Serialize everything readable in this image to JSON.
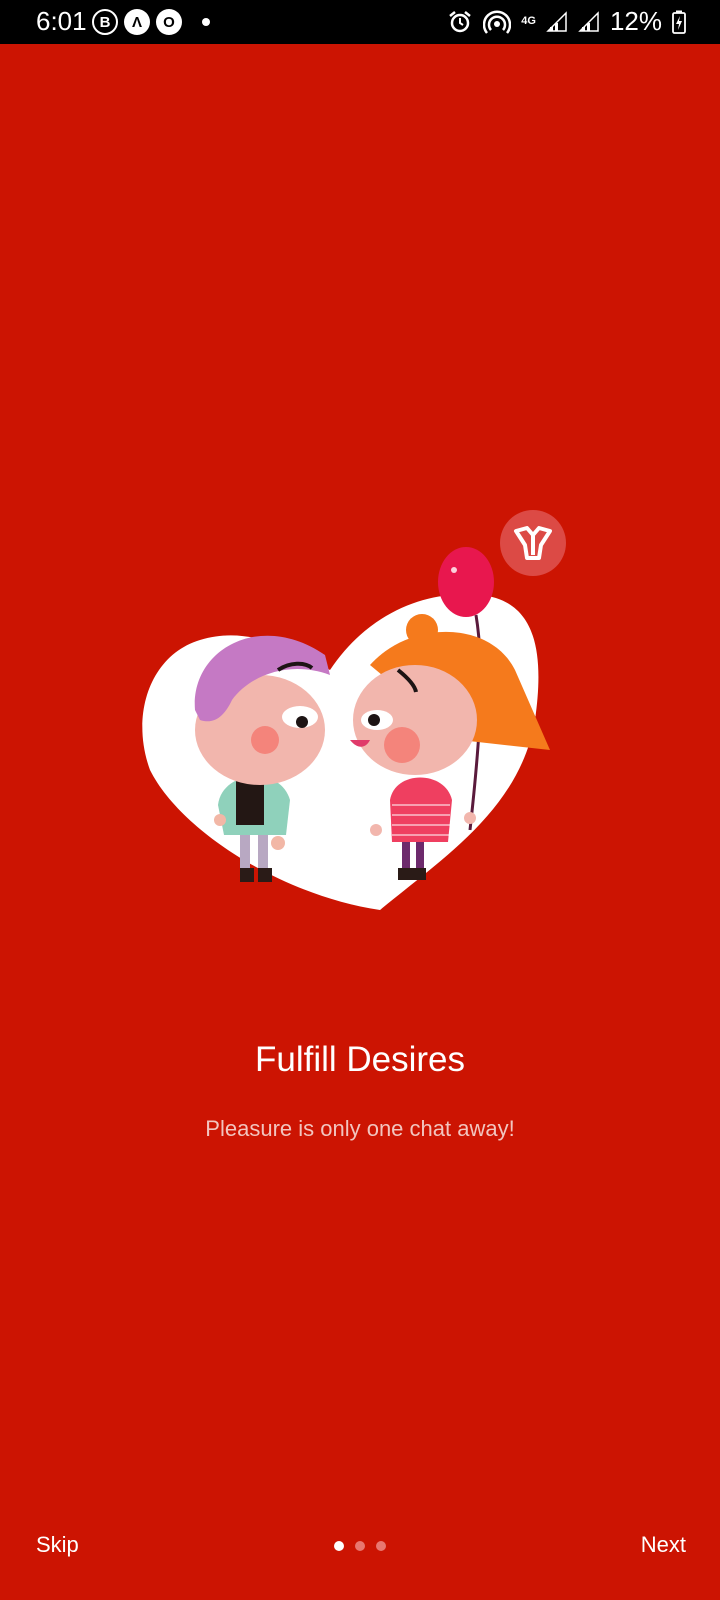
{
  "status_bar": {
    "time": "6:01",
    "left_icons": [
      {
        "icon": "b-badge-icon",
        "glyph": "B"
      },
      {
        "icon": "a-badge-icon",
        "glyph": "Λ"
      },
      {
        "icon": "o-badge-icon",
        "glyph": "O"
      }
    ],
    "network": "4G",
    "battery_percent": "12%"
  },
  "onboarding": {
    "title": "Fulfill Desires",
    "subtitle": "Pleasure is only one chat away!",
    "page_count": 3,
    "active_page": 0
  },
  "navigation": {
    "skip_label": "Skip",
    "next_label": "Next"
  },
  "colors": {
    "background": "#cc1402",
    "logo_badge": "#dc4a45",
    "dot_inactive": "#e87770",
    "dot_active": "#ffffff"
  }
}
